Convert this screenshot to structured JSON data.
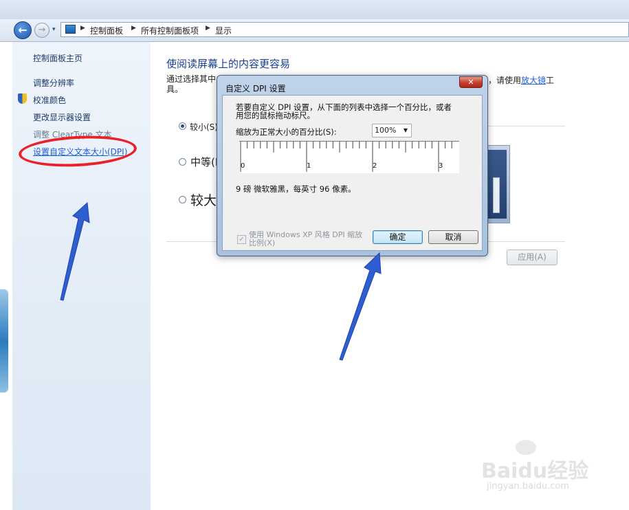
{
  "nav": {
    "back_glyph": "←",
    "forward_glyph": "→",
    "history_glyph": "▾",
    "breadcrumbs": [
      "控制面板",
      "所有控制面板项",
      "显示"
    ],
    "sep": "▶"
  },
  "sidebar": {
    "home": "控制面板主页",
    "items": [
      "调整分辨率",
      "校准颜色",
      "更改显示器设置",
      "调整 ClearType 文本",
      "设置自定义文本大小(DPI)"
    ]
  },
  "main": {
    "title": "使阅读屏幕上的内容更容易",
    "desc_prefix": "通过选择其中",
    "desc_line1_tail": "，请使用",
    "magnifier_link": "放大镜",
    "desc_link_tail": "工",
    "desc_line2": "具。",
    "options": [
      "较小(S)",
      "中等(M)",
      "较大"
    ],
    "apply_label": "应用(A)"
  },
  "dialog": {
    "title": "自定义 DPI 设置",
    "close_glyph": "✕",
    "instruction": "若要自定义 DPI 设置，从下面的列表中选择一个百分比，或者用您的鼠标拖动标尺。",
    "scale_label": "缩放为正常大小的百分比(S):",
    "scale_value": "100%",
    "ruler_labels": [
      "0",
      "1",
      "2",
      "3"
    ],
    "font_info": "9 磅 微软雅黑，每英寸 96 像素。",
    "xp_checkbox_label": "使用 Windows XP 风格 DPI 缩放比例(X)",
    "xp_checked": true,
    "ok_label": "确定",
    "cancel_label": "取消"
  },
  "watermark": {
    "brand": "Baidu经验",
    "url": "jingyan.baidu.com"
  },
  "colors": {
    "annotation_red": "#e8222a",
    "annotation_arrow": "#2f5ed0",
    "link": "#1f5fd1"
  }
}
